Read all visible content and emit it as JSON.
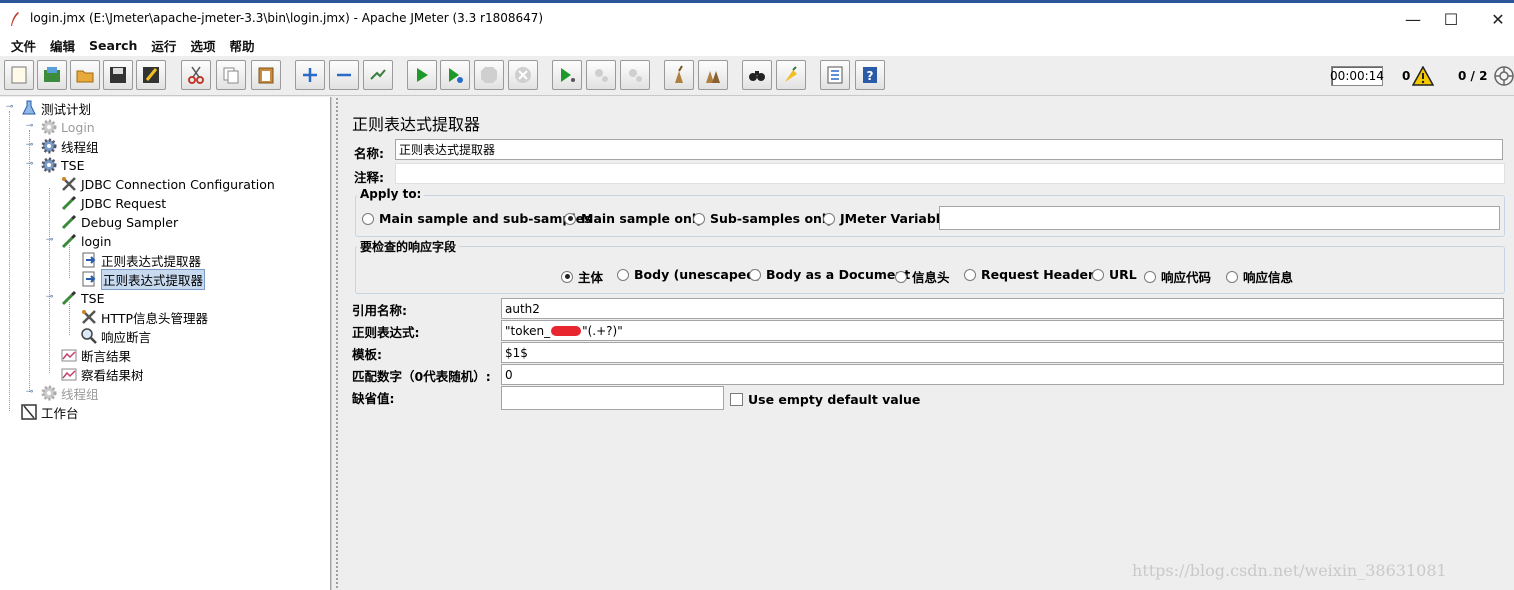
{
  "window": {
    "title": "login.jmx (E:\\Jmeter\\apache-jmeter-3.3\\bin\\login.jmx) - Apache JMeter (3.3 r1808647)",
    "min_glyph": "—",
    "max_glyph": "☐",
    "close_glyph": "✕"
  },
  "menu": [
    "文件",
    "编辑",
    "Search",
    "运行",
    "选项",
    "帮助"
  ],
  "status": {
    "timer": "00:00:14",
    "warnings": "0",
    "threads": "0 / 2"
  },
  "tree": {
    "items": [
      {
        "label": "测试计划"
      },
      {
        "label": "Login"
      },
      {
        "label": "线程组"
      },
      {
        "label": "TSE"
      },
      {
        "label": "JDBC Connection Configuration"
      },
      {
        "label": "JDBC Request"
      },
      {
        "label": "Debug Sampler"
      },
      {
        "label": "login"
      },
      {
        "label": "正则表达式提取器"
      },
      {
        "label": "正则表达式提取器"
      },
      {
        "label": "TSE"
      },
      {
        "label": "HTTP信息头管理器"
      },
      {
        "label": "响应断言"
      },
      {
        "label": "断言结果"
      },
      {
        "label": "察看结果树"
      },
      {
        "label": "线程组"
      },
      {
        "label": "工作台"
      }
    ]
  },
  "panel": {
    "title": "正则表达式提取器",
    "name_label": "名称:",
    "name_value": "正则表达式提取器",
    "comment_label": "注释:",
    "comment_value": "",
    "apply_to": {
      "legend": "Apply to:",
      "options": [
        "Main sample and sub-samples",
        "Main sample only",
        "Sub-samples only",
        "JMeter Variable"
      ],
      "selected": "Main sample only",
      "variable_value": ""
    },
    "field_check": {
      "legend": "要检查的响应字段",
      "options": [
        "主体",
        "Body (unescaped)",
        "Body as a Document",
        "信息头",
        "Request Headers",
        "URL",
        "响应代码",
        "响应信息"
      ],
      "selected": "主体"
    },
    "ref_name_label": "引用名称:",
    "ref_name_value": "auth2",
    "regex_label": "正则表达式:",
    "regex_value_start": "\"token_",
    "regex_value_end": "\"(.+?)\"",
    "template_label": "模板:",
    "template_value": "$1$",
    "match_no_label": "匹配数字（0代表随机）:",
    "match_no_value": "0",
    "default_label": "缺省值:",
    "default_value": "",
    "use_empty_label": "Use empty default value"
  },
  "watermark": "https://blog.csdn.net/weixin_38631081"
}
